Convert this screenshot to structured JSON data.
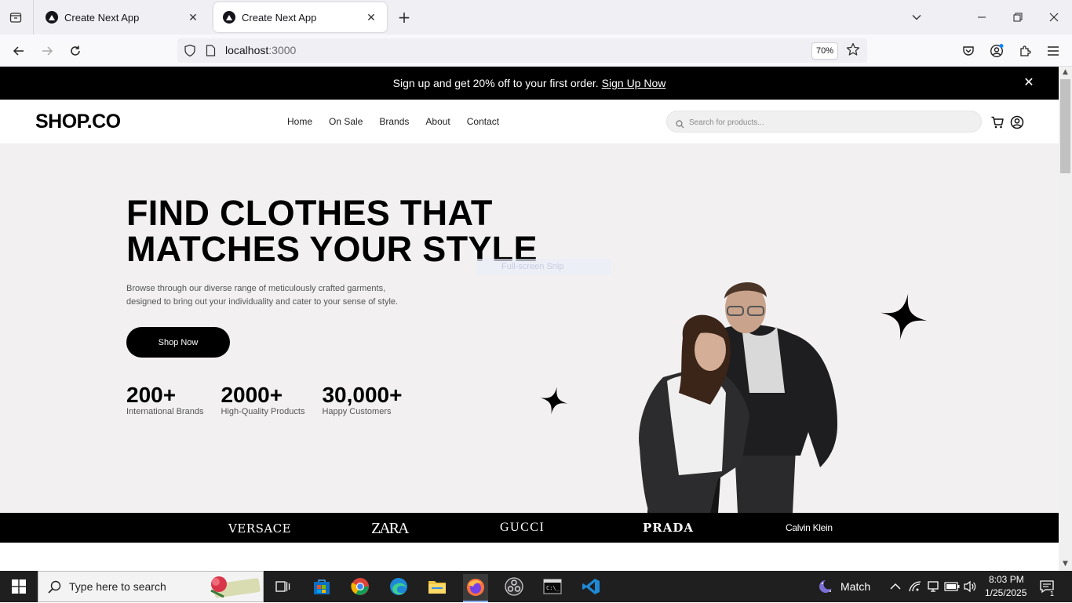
{
  "browser": {
    "tabs": [
      {
        "title": "Create Next App",
        "active": false
      },
      {
        "title": "Create Next App",
        "active": true
      }
    ],
    "new_tab": "+",
    "url_host": "localhost",
    "url_port": ":3000",
    "zoom": "70%"
  },
  "site": {
    "promo": {
      "text": "Sign up and get 20% off to your first order.",
      "link": "Sign Up Now",
      "close": "✕"
    },
    "logo": "SHOP.CO",
    "nav": [
      "Home",
      "On Sale",
      "Brands",
      "About",
      "Contact"
    ],
    "search_placeholder": "Search for products...",
    "hero": {
      "title_line1": "FIND CLOTHES THAT",
      "title_line2": "MATCHES YOUR STYLE",
      "desc_line1": "Browse through our diverse range of meticulously crafted garments,",
      "desc_line2": "designed to bring out your individuality and cater to your sense of style.",
      "cta": "Shop Now",
      "stats": [
        {
          "value": "200+",
          "label": "International Brands"
        },
        {
          "value": "2000+",
          "label": "High-Quality Products"
        },
        {
          "value": "30,000+",
          "label": "Happy Customers"
        }
      ]
    },
    "snip_overlay": "Full-screen Snip",
    "brands": [
      "VERSACE",
      "ZARA",
      "GUCCI",
      "PRADA",
      "Calvin Klein"
    ]
  },
  "taskbar": {
    "search_text": "Type here to search",
    "weather": "Match",
    "time": "8:03 PM",
    "date": "1/25/2025",
    "notifications": "1"
  },
  "colors": {
    "brand_black": "#000000",
    "hero_bg": "#f2f0f1",
    "chrome_bg": "#f0f0f4"
  }
}
